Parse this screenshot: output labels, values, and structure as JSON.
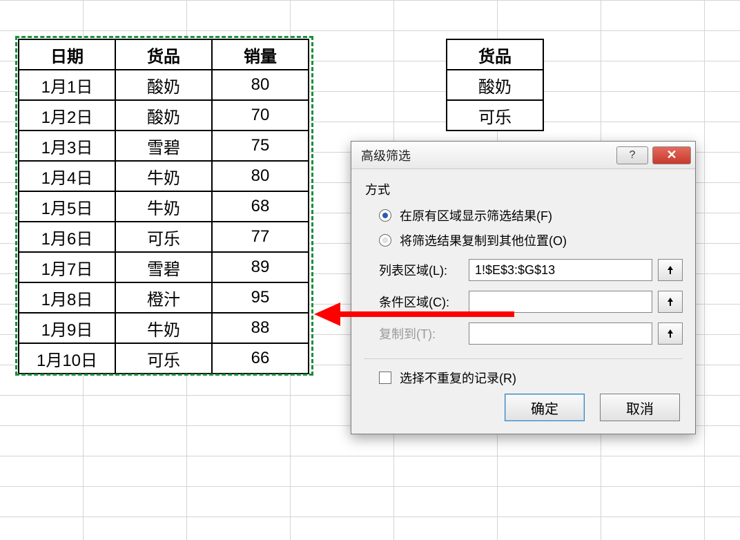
{
  "main_table": {
    "headers": [
      "日期",
      "货品",
      "销量"
    ],
    "rows": [
      [
        "1月1日",
        "酸奶",
        "80"
      ],
      [
        "1月2日",
        "酸奶",
        "70"
      ],
      [
        "1月3日",
        "雪碧",
        "75"
      ],
      [
        "1月4日",
        "牛奶",
        "80"
      ],
      [
        "1月5日",
        "牛奶",
        "68"
      ],
      [
        "1月6日",
        "可乐",
        "77"
      ],
      [
        "1月7日",
        "雪碧",
        "89"
      ],
      [
        "1月8日",
        "橙汁",
        "95"
      ],
      [
        "1月9日",
        "牛奶",
        "88"
      ],
      [
        "1月10日",
        "可乐",
        "66"
      ]
    ]
  },
  "side_table": {
    "header": "货品",
    "rows": [
      "酸奶",
      "可乐"
    ]
  },
  "dialog": {
    "title": "高级筛选",
    "group_mode": "方式",
    "radio_inplace": "在原有区域显示筛选结果(F)",
    "radio_copy": "将筛选结果复制到其他位置(O)",
    "label_list": "列表区域(L):",
    "label_criteria": "条件区域(C):",
    "label_copyto": "复制到(T):",
    "value_list": "1!$E$3:$G$13",
    "value_criteria": "",
    "value_copyto": "",
    "check_unique": "选择不重复的记录(R)",
    "btn_ok": "确定",
    "btn_cancel": "取消"
  }
}
